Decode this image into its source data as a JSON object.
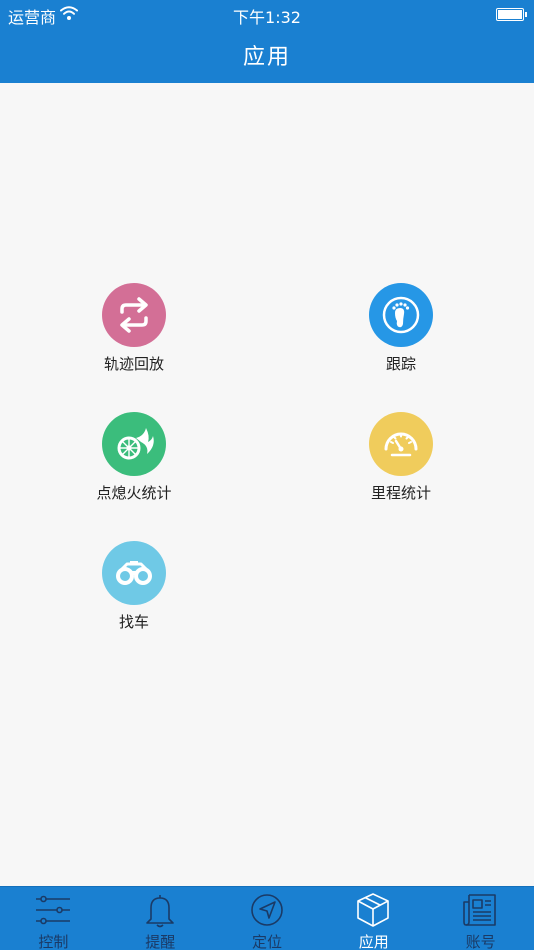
{
  "status_bar": {
    "carrier": "运营商",
    "time": "下午1:32"
  },
  "header": {
    "title": "应用"
  },
  "apps": [
    {
      "label": "轨迹回放",
      "icon": "repeat-arrows-icon",
      "color": "#d36f96"
    },
    {
      "label": "跟踪",
      "icon": "footprint-icon",
      "color": "#2697e6"
    },
    {
      "label": "点熄火统计",
      "icon": "flaming-wheel-icon",
      "color": "#3bbd7c"
    },
    {
      "label": "里程统计",
      "icon": "speedometer-icon",
      "color": "#f0cc5c"
    },
    {
      "label": "找车",
      "icon": "binoculars-icon",
      "color": "#6fc9e6"
    }
  ],
  "tab_bar": {
    "active": "应用",
    "tabs": [
      {
        "label": "控制",
        "icon": "sliders-icon"
      },
      {
        "label": "提醒",
        "icon": "bell-icon"
      },
      {
        "label": "定位",
        "icon": "compass-icon"
      },
      {
        "label": "应用",
        "icon": "box-icon"
      },
      {
        "label": "账号",
        "icon": "newspaper-icon"
      }
    ]
  }
}
